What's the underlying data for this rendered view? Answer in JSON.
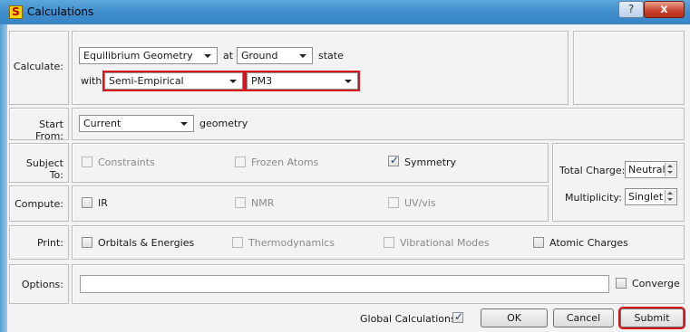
{
  "window": {
    "title": "Calculations",
    "app_icon_letter": "S",
    "help_glyph": "?",
    "close_glyph": "x"
  },
  "calculate": {
    "label": "Calculate:",
    "task_value": "Equilibrium Geometry",
    "at_text": "at",
    "state_value": "Ground",
    "state_text": "state",
    "with_text": "with",
    "method_value": "Semi-Empirical",
    "model_value": "PM3"
  },
  "start_from": {
    "label": "Start From:",
    "value": "Current",
    "suffix": "geometry"
  },
  "subject_to": {
    "label": "Subject To:",
    "options": [
      {
        "label": "Constraints",
        "checked": false,
        "enabled": false
      },
      {
        "label": "Frozen Atoms",
        "checked": false,
        "enabled": false
      },
      {
        "label": "Symmetry",
        "checked": true,
        "enabled": true
      }
    ]
  },
  "compute": {
    "label": "Compute:",
    "options": [
      {
        "label": "IR",
        "checked": false,
        "enabled": true
      },
      {
        "label": "NMR",
        "checked": false,
        "enabled": false
      },
      {
        "label": "UV/vis",
        "checked": false,
        "enabled": false
      }
    ]
  },
  "charge": {
    "total_charge_label": "Total Charge:",
    "total_charge_value": "Neutral",
    "multiplicity_label": "Multiplicity:",
    "multiplicity_value": "Singlet"
  },
  "print": {
    "label": "Print:",
    "options": [
      {
        "label": "Orbitals & Energies",
        "checked": false,
        "enabled": true
      },
      {
        "label": "Thermodynamics",
        "checked": false,
        "enabled": false
      },
      {
        "label": "Vibrational Modes",
        "checked": false,
        "enabled": false
      },
      {
        "label": "Atomic Charges",
        "checked": false,
        "enabled": true
      }
    ]
  },
  "options": {
    "label": "Options:",
    "value": "",
    "converge_label": "Converge",
    "converge_checked": false
  },
  "footer": {
    "global_calculations_label": "Global Calculations",
    "global_calculations_checked": true,
    "ok_label": "OK",
    "cancel_label": "Cancel",
    "submit_label": "Submit"
  },
  "colors": {
    "highlight": "#d8141a",
    "titlebar": "#3c8ccc"
  }
}
